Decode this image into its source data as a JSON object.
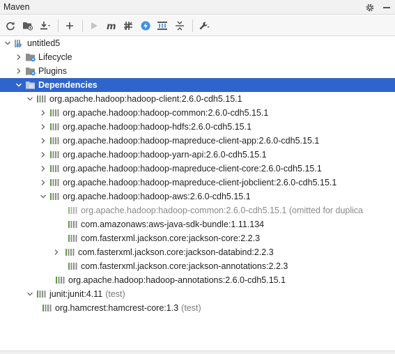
{
  "window": {
    "title": "Maven"
  },
  "header_icons": [
    "gear-icon",
    "minimize-icon"
  ],
  "toolbar": {
    "buttons": [
      "reload-icon",
      "add-folder-icon",
      "download-icon",
      "plus-icon",
      "run-icon",
      "maven-icon",
      "toggle-offline-icon",
      "lightning-icon",
      "show-dependencies-icon",
      "collapse-all-icon",
      "wrench-icon"
    ]
  },
  "colors": {
    "selection": "#2f65ca",
    "maven_icon_bar": "#5d9d43",
    "module_icon_blue": "#3d8ee9"
  },
  "tree": {
    "root": {
      "label": "untitled5"
    },
    "lifecycle": {
      "label": "Lifecycle"
    },
    "plugins": {
      "label": "Plugins"
    },
    "dependencies": {
      "label": "Dependencies"
    },
    "d1": {
      "label": "org.apache.hadoop:hadoop-client:2.6.0-cdh5.15.1"
    },
    "d1_1": {
      "label": "org.apache.hadoop:hadoop-common:2.6.0-cdh5.15.1"
    },
    "d1_2": {
      "label": "org.apache.hadoop:hadoop-hdfs:2.6.0-cdh5.15.1"
    },
    "d1_3": {
      "label": "org.apache.hadoop:hadoop-mapreduce-client-app:2.6.0-cdh5.15.1"
    },
    "d1_4": {
      "label": "org.apache.hadoop:hadoop-yarn-api:2.6.0-cdh5.15.1"
    },
    "d1_5": {
      "label": "org.apache.hadoop:hadoop-mapreduce-client-core:2.6.0-cdh5.15.1"
    },
    "d1_6": {
      "label": "org.apache.hadoop:hadoop-mapreduce-client-jobclient:2.6.0-cdh5.15.1"
    },
    "d1_7": {
      "label": "org.apache.hadoop:hadoop-aws:2.6.0-cdh5.15.1"
    },
    "d1_7_1": {
      "label": "org.apache.hadoop:hadoop-common:2.6.0-cdh5.15.1 (omitted for duplica"
    },
    "d1_7_2": {
      "label": "com.amazonaws:aws-java-sdk-bundle:1.11.134"
    },
    "d1_7_3": {
      "label": "com.fasterxml.jackson.core:jackson-core:2.2.3"
    },
    "d1_7_4": {
      "label": "com.fasterxml.jackson.core:jackson-databind:2.2.3"
    },
    "d1_7_5": {
      "label": "com.fasterxml.jackson.core:jackson-annotations:2.2.3"
    },
    "d1_8": {
      "label": "org.apache.hadoop:hadoop-annotations:2.6.0-cdh5.15.1"
    },
    "d2": {
      "label": "junit:junit:4.11",
      "scope": "(test)"
    },
    "d2_1": {
      "label": "org.hamcrest:hamcrest-core:1.3",
      "scope": "(test)"
    }
  }
}
